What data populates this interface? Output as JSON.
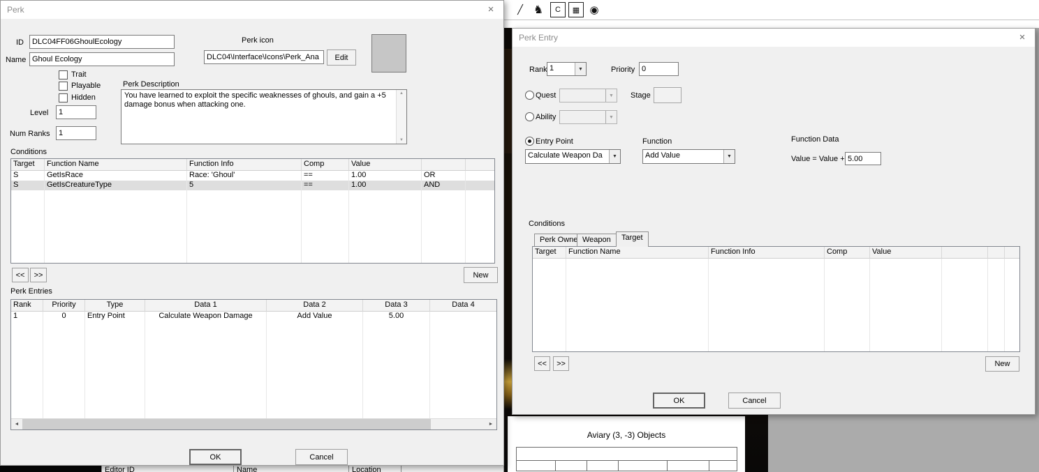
{
  "glyphs": {
    "close": "×",
    "combo_arrow": "▼",
    "scroll_up": "▲",
    "scroll_down": "▼",
    "scroll_left": "◄",
    "scroll_right": "►"
  },
  "toolbar": {
    "icons": [
      {
        "name": "pen-icon",
        "glyph": "╱"
      },
      {
        "name": "creature-icon",
        "glyph": "♞"
      },
      {
        "name": "cell-icon",
        "glyph": "C"
      },
      {
        "name": "grid-icon",
        "glyph": "▦"
      },
      {
        "name": "target-icon",
        "glyph": "◉"
      }
    ]
  },
  "background": {
    "aviary_label": "Aviary (3, -3) Objects",
    "bottom_headers": [
      "Editor ID",
      "Name",
      "Location",
      ""
    ]
  },
  "perk_dialog": {
    "title": "Perk",
    "id_label": "ID",
    "id_value": "DLC04FF06GhoulEcology",
    "name_label": "Name",
    "name_value": "Ghoul Ecology",
    "checkboxes": [
      {
        "label": "Trait",
        "checked": false
      },
      {
        "label": "Playable",
        "checked": false
      },
      {
        "label": "Hidden",
        "checked": false
      }
    ],
    "level_label": "Level",
    "level_value": "1",
    "num_ranks_label": "Num Ranks",
    "num_ranks_value": "1",
    "perk_icon_label": "Perk icon",
    "perk_icon_path": "DLC04\\Interface\\Icons\\Perk_Ana",
    "edit_button": "Edit",
    "description_label": "Perk Description",
    "description_text": "You have learned to exploit the specific weaknesses of ghouls, and gain a +5 damage bonus when attacking one.",
    "conditions_label": "Conditions",
    "conditions_table": {
      "headers": [
        "Target",
        "Function Name",
        "Function Info",
        "Comp",
        "Value",
        "",
        ""
      ],
      "rows": [
        [
          "S",
          "GetIsRace",
          "Race: 'Ghoul'",
          "==",
          "1.00",
          "OR",
          ""
        ],
        [
          "S",
          "GetIsCreatureType",
          "5",
          "==",
          "1.00",
          "AND",
          ""
        ]
      ],
      "selected_row_index": 1
    },
    "prev_button": "<<",
    "next_button": ">>",
    "new_button": "New",
    "perk_entries_label": "Perk Entries",
    "perk_entries_table": {
      "headers": [
        "Rank",
        "Priority",
        "Type",
        "Data 1",
        "Data 2",
        "Data 3",
        "Data 4"
      ],
      "rows": [
        [
          "1",
          "0",
          "Entry Point",
          "Calculate Weapon Damage",
          "Add Value",
          "5.00",
          ""
        ]
      ]
    },
    "ok_button": "OK",
    "cancel_button": "Cancel"
  },
  "perk_entry_dialog": {
    "title": "Perk Entry",
    "rank_label": "Rank",
    "rank_value": "1",
    "priority_label": "Priority",
    "priority_value": "0",
    "quest_label": "Quest",
    "stage_label": "Stage",
    "ability_label": "Ability",
    "entry_point_label": "Entry Point",
    "selected_option": "Entry Point",
    "entry_point_value": "Calculate Weapon Da",
    "function_label": "Function",
    "function_value": "Add Value",
    "function_data_label": "Function Data",
    "value_expr_label": "Value = Value +",
    "value_input": "5.00",
    "conditions_label": "Conditions",
    "tabs": [
      "Perk Owner",
      "Weapon",
      "Target"
    ],
    "active_tab": "Target",
    "conditions_table": {
      "headers": [
        "Target",
        "Function Name",
        "Function Info",
        "Comp",
        "Value",
        "",
        "",
        ""
      ],
      "rows": []
    },
    "prev_button": "<<",
    "next_button": ">>",
    "new_button": "New",
    "ok_button": "OK",
    "cancel_button": "Cancel"
  }
}
